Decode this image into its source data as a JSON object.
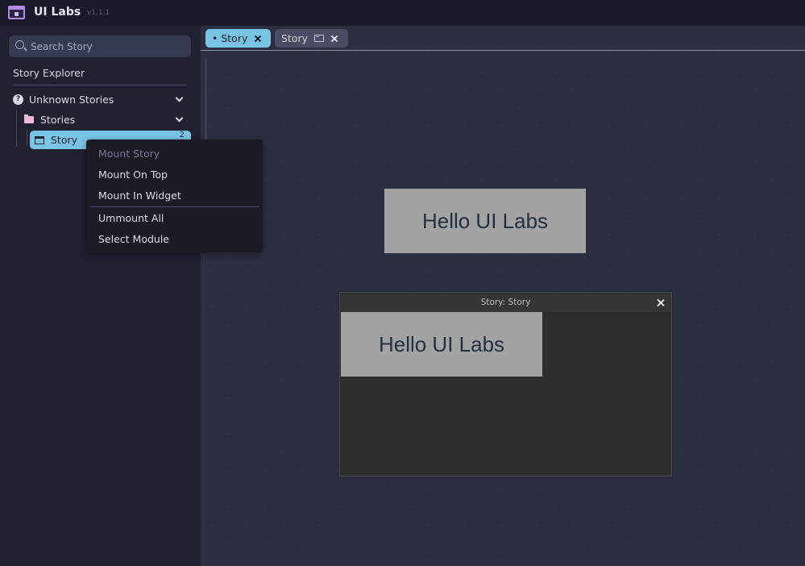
{
  "app": {
    "title": "UI Labs",
    "version": "v1.1.1"
  },
  "sidebar": {
    "search_placeholder": "Search Story",
    "explorer_title": "Story Explorer",
    "tree": {
      "group": {
        "label": "Unknown Stories",
        "icon": "question-circle-icon"
      },
      "folder": {
        "label": "Stories",
        "icon": "folder-icon"
      },
      "story": {
        "label": "Story",
        "icon": "story-icon",
        "count": "2"
      }
    }
  },
  "context_menu": {
    "items": [
      {
        "label": "Mount Story",
        "disabled": true
      },
      {
        "label": "Mount On Top",
        "disabled": false
      },
      {
        "label": "Mount In Widget",
        "disabled": false
      },
      {
        "label": "Ummount All",
        "disabled": false
      },
      {
        "label": "Select Module",
        "disabled": false
      }
    ]
  },
  "tabs": [
    {
      "label": "• Story",
      "active": true
    },
    {
      "label": "Story",
      "active": false,
      "icon": "widget-icon"
    }
  ],
  "preview": {
    "text": "Hello UI Labs"
  },
  "widget_window": {
    "title": "Story: Story",
    "content_text": "Hello UI Labs"
  },
  "colors": {
    "accent": "#79c4e4",
    "background": "#252739",
    "sidebar": "#1f2030",
    "topbar": "#191a27"
  }
}
